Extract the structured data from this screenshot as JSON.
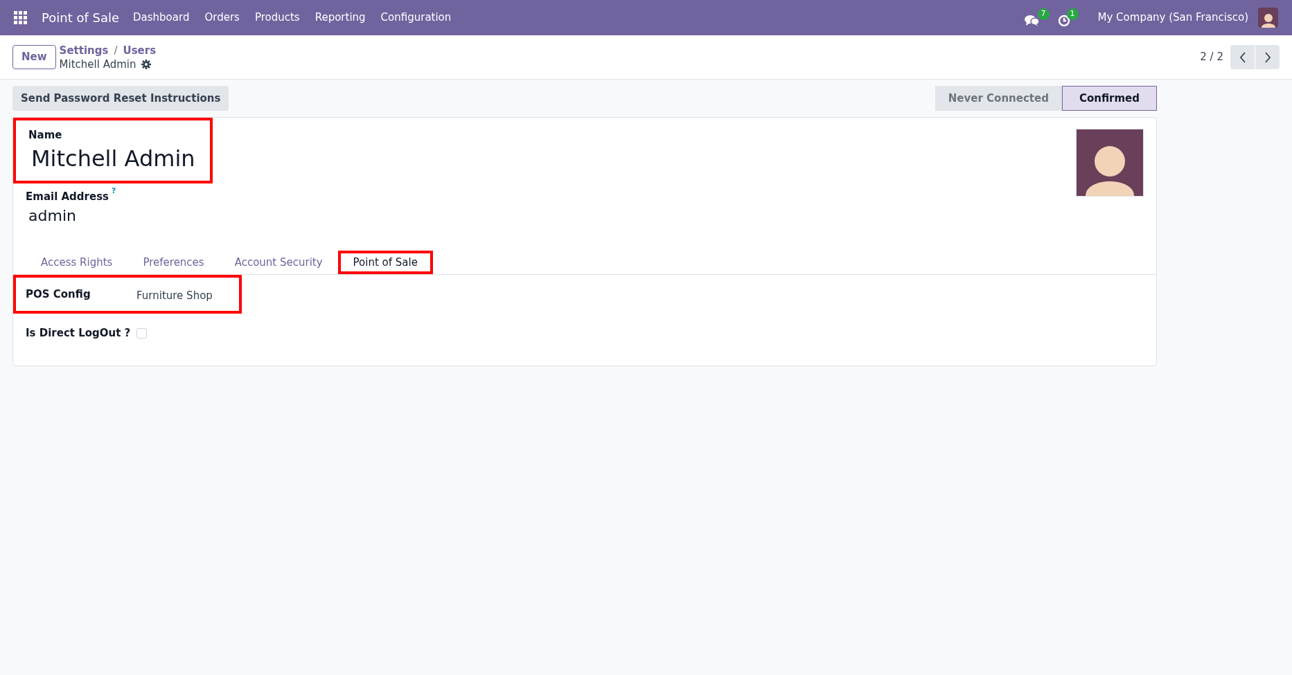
{
  "navbar": {
    "app_name": "Point of Sale",
    "menu": [
      "Dashboard",
      "Orders",
      "Products",
      "Reporting",
      "Configuration"
    ],
    "messages_count": "7",
    "activities_count": "1",
    "company": "My Company (San Francisco)"
  },
  "control_panel": {
    "new_button": "New",
    "breadcrumbs": [
      "Settings",
      "Users"
    ],
    "breadcrumb_separator": "/",
    "record_title": "Mitchell Admin",
    "pager": "2 / 2"
  },
  "actions": [
    "Send Password Reset Instructions"
  ],
  "status_stages": [
    {
      "label": "Never Connected",
      "selected": false
    },
    {
      "label": "Confirmed",
      "selected": true
    }
  ],
  "form": {
    "name_label": "Name",
    "name_value": "Mitchell Admin",
    "name_highlighted": true,
    "email_label": "Email Address",
    "email_help": "?",
    "email_value": "admin"
  },
  "tabs": [
    {
      "label": "Access Rights",
      "selected": false,
      "highlighted": false
    },
    {
      "label": "Preferences",
      "selected": false,
      "highlighted": false
    },
    {
      "label": "Account Security",
      "selected": false,
      "highlighted": false
    },
    {
      "label": "Point of Sale",
      "selected": true,
      "highlighted": true
    }
  ],
  "pos_fields": [
    {
      "kind": "text",
      "label": "POS Config",
      "value": "Furniture Shop",
      "highlighted": true
    },
    {
      "kind": "checkbox",
      "label": "Is Direct LogOut ?",
      "checked": false,
      "highlighted": false
    }
  ]
}
